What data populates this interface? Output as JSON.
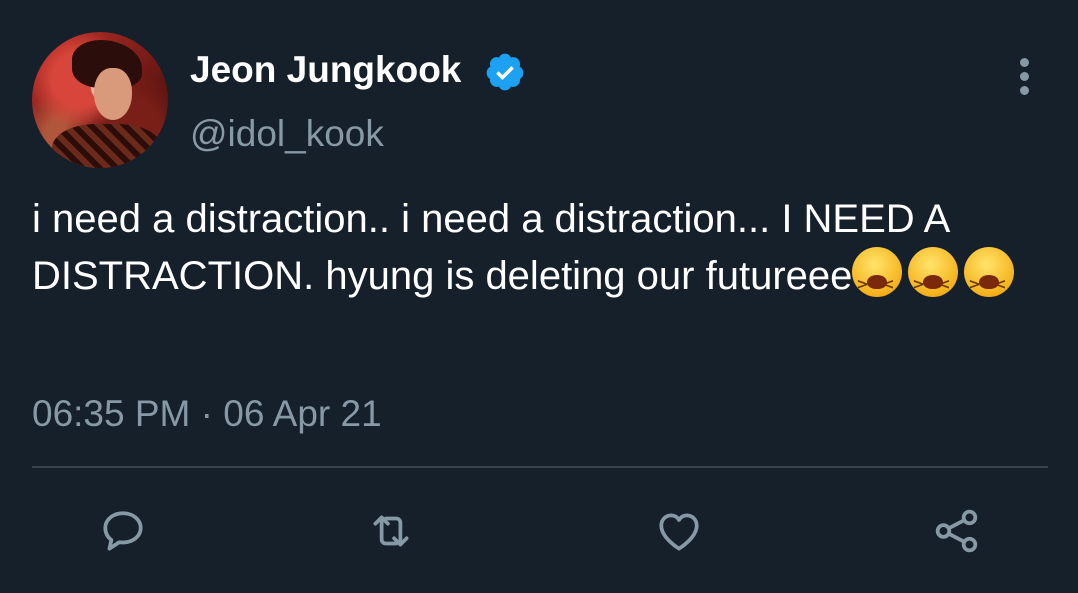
{
  "tweet": {
    "author": {
      "display_name": "Jeon Jungkook",
      "handle": "@idol_kook",
      "verified": true,
      "avatar_icon": "profile-photo"
    },
    "text": "i need a distraction.. i need a distraction... I NEED A DISTRACTION. hyung is deleting our futureee",
    "emojis": [
      "tired-face",
      "tired-face",
      "tired-face"
    ],
    "timestamp": "06:35 PM · 06 Apr 21"
  },
  "actions": [
    {
      "name": "reply",
      "icon": "speech-bubble-icon"
    },
    {
      "name": "retweet",
      "icon": "retweet-icon"
    },
    {
      "name": "like",
      "icon": "heart-icon"
    },
    {
      "name": "share",
      "icon": "share-icon"
    }
  ],
  "colors": {
    "background": "#15202b",
    "primary_text": "#ffffff",
    "secondary_text": "#8899a6",
    "accent": "#1da1f2",
    "divider": "#38444d"
  }
}
